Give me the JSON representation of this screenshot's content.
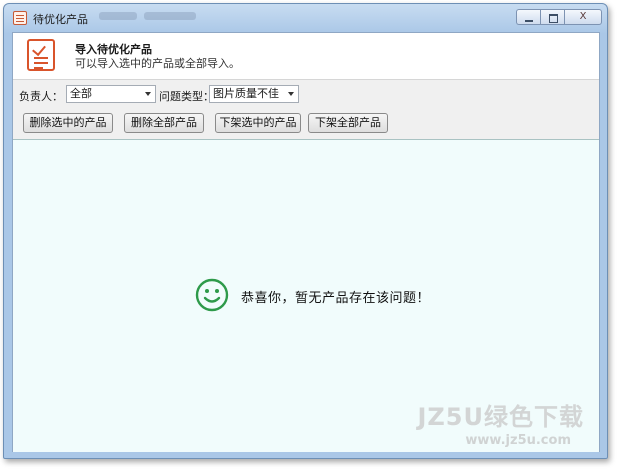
{
  "window": {
    "title": "待优化产品",
    "close_label": "X"
  },
  "header": {
    "title": "导入待优化产品",
    "subtitle": "可以导入选中的产品或全部导入。"
  },
  "filters": {
    "owner_label": "负责人：",
    "owner_value": "全部",
    "issue_label": "问题类型：",
    "issue_value": "图片质量不佳"
  },
  "toolbar": {
    "delete_selected": "删除选中的产品",
    "delete_all": "删除全部产品",
    "unlist_selected": "下架选中的产品",
    "unlist_all": "下架全部产品"
  },
  "content": {
    "empty_message": "恭喜你，暂无产品存在该问题！"
  },
  "watermark": {
    "line1": "JZ5U绿色下载",
    "line2": "www.jz5u.com"
  },
  "colors": {
    "accent": "#d9542b",
    "smiley": "#2e9a4a",
    "content_bg": "#f1fcfc"
  }
}
